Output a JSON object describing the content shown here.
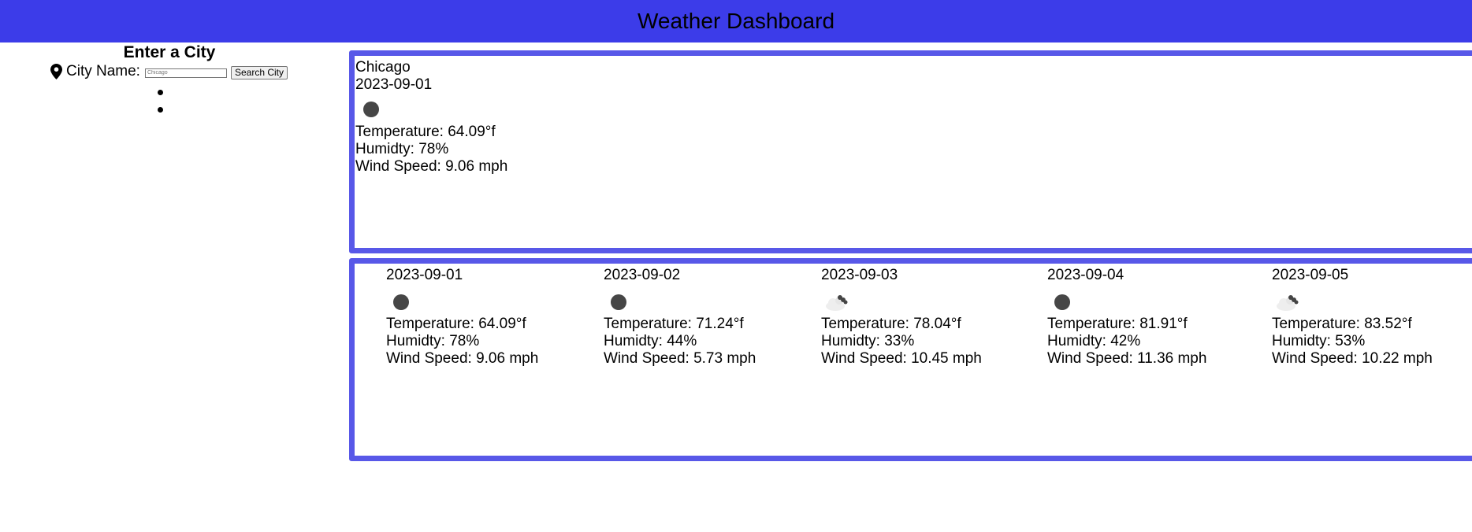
{
  "header": {
    "title": "Weather Dashboard"
  },
  "sidebar": {
    "heading": "Enter a City",
    "city_label": "City Name:",
    "input_value": "Chicago",
    "search_button": "Search City",
    "history": [
      "",
      ""
    ]
  },
  "current": {
    "city": "Chicago",
    "date": "2023-09-01",
    "icon": "clear-night-icon",
    "temperature": "Temperature: 64.09°f",
    "humidity": "Humidty: 78%",
    "wind": "Wind Speed: 9.06 mph"
  },
  "forecast": [
    {
      "date": "2023-09-01",
      "icon": "clear-night-icon",
      "temperature": "Temperature: 64.09°f",
      "humidity": "Humidty: 78%",
      "wind": "Wind Speed: 9.06 mph"
    },
    {
      "date": "2023-09-02",
      "icon": "clear-night-icon",
      "temperature": "Temperature: 71.24°f",
      "humidity": "Humidty: 44%",
      "wind": "Wind Speed: 5.73 mph"
    },
    {
      "date": "2023-09-03",
      "icon": "few-clouds-icon",
      "temperature": "Temperature: 78.04°f",
      "humidity": "Humidty: 33%",
      "wind": "Wind Speed: 10.45 mph"
    },
    {
      "date": "2023-09-04",
      "icon": "clear-night-icon",
      "temperature": "Temperature: 81.91°f",
      "humidity": "Humidty: 42%",
      "wind": "Wind Speed: 11.36 mph"
    },
    {
      "date": "2023-09-05",
      "icon": "few-clouds-icon",
      "temperature": "Temperature: 83.52°f",
      "humidity": "Humidty: 53%",
      "wind": "Wind Speed: 10.22 mph"
    }
  ],
  "colors": {
    "header_bg": "#3c3ce9",
    "panel_border": "#5858e8"
  }
}
